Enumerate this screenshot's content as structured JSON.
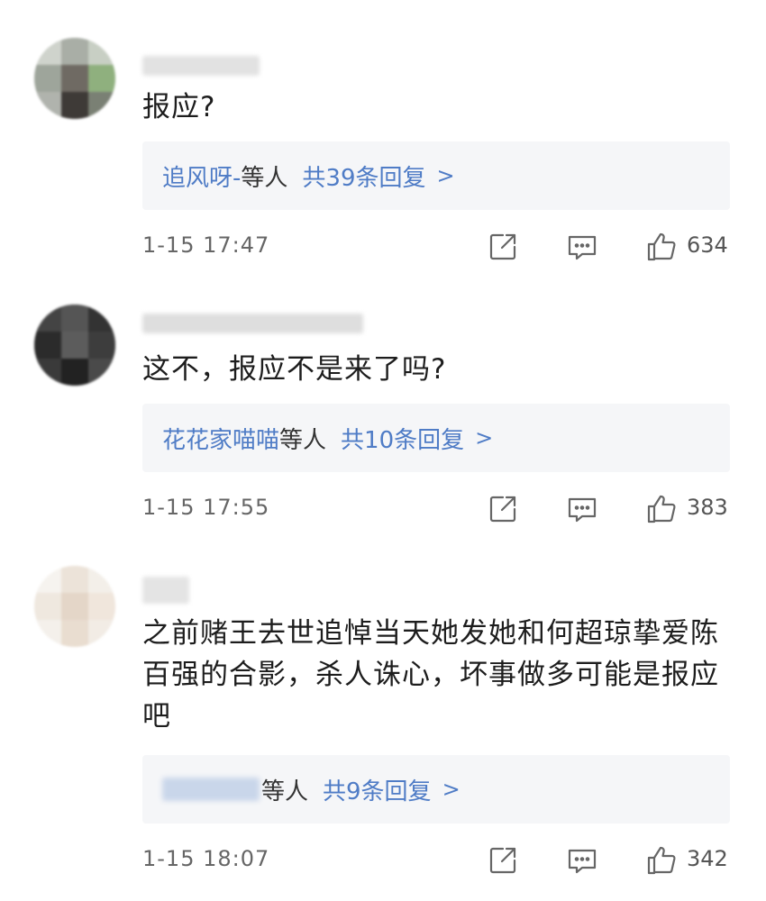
{
  "comments": [
    {
      "text": "报应?",
      "reply_users": "追风呀-",
      "reply_deng": "等人",
      "reply_count": "共39条回复",
      "time": "1-15 17:47",
      "likes": "634"
    },
    {
      "text": "这不，报应不是来了吗?",
      "reply_users": "花花家喵喵",
      "reply_deng": "等人",
      "reply_count": "共10条回复",
      "time": "1-15 17:55",
      "likes": "383"
    },
    {
      "text": "之前赌王去世追悼当天她发她和何超琼挚爱陈百强的合影，杀人诛心，坏事做多可能是报应吧",
      "reply_users": "",
      "reply_deng": "等人",
      "reply_count": "共9条回复",
      "time": "1-15 18:07",
      "likes": "342"
    }
  ],
  "icons": {
    "share": "share-icon",
    "comment": "comment-icon",
    "like": "thumbs-up-icon",
    "chevron": "chevron-right-icon"
  },
  "colors": {
    "link": "#4f7cc6",
    "reply_bg": "#f5f6f8",
    "meta_text": "#666666"
  },
  "chevron_glyph": ">"
}
